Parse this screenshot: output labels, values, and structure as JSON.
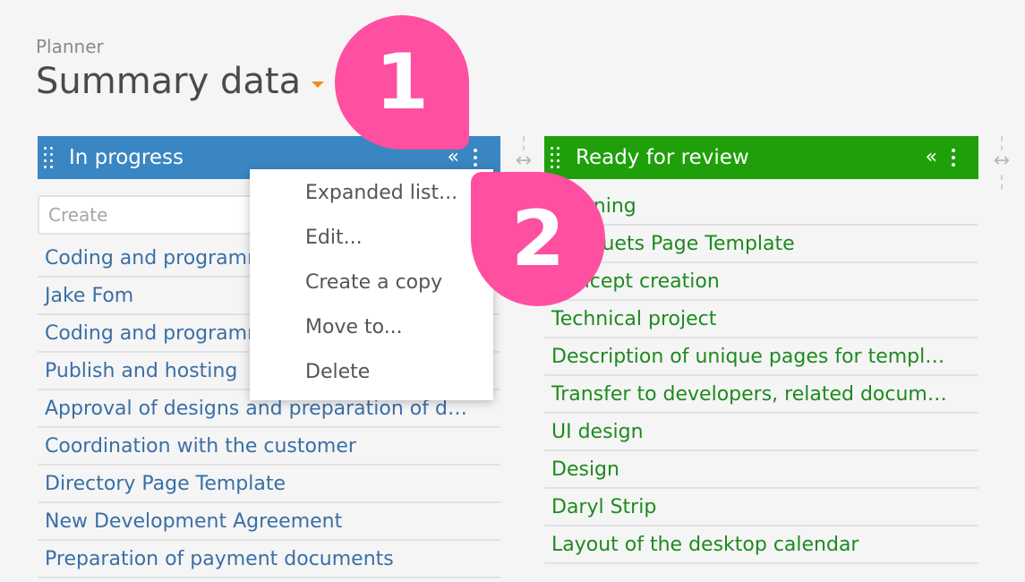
{
  "header": {
    "breadcrumb": "Planner",
    "title": "Summary data"
  },
  "columns": [
    {
      "title": "In progress",
      "color": "#3a86c2",
      "create_placeholder": "Create",
      "cards": [
        "Coding and programming",
        "Jake Fom",
        "Coding and programming",
        "Publish and hosting",
        "Approval of designs and preparation of d…",
        "Coordination with the customer",
        "Directory Page Template",
        "New Development Agreement",
        "Preparation of payment documents"
      ]
    },
    {
      "title": "Ready for review",
      "color": "#1fa00a",
      "cards": [
        "Planning",
        "Bouquets Page Template",
        "Concept creation",
        "Technical project",
        "Description of unique pages for templ…",
        "Transfer to developers, related docum…",
        "UI design",
        "Design",
        "Daryl Strip",
        "Layout of the desktop calendar"
      ]
    }
  ],
  "context_menu": {
    "items": [
      "Expanded list...",
      "Edit...",
      "Create a copy",
      "Move to...",
      "Delete"
    ]
  },
  "callouts": [
    "1",
    "2"
  ],
  "icons": {
    "collapse": "«",
    "resize": "↔",
    "title_dropdown": "caret-down",
    "more": "vertical-ellipsis",
    "drag": "drag-dots"
  },
  "colors": {
    "accent_orange": "#f08c1e",
    "callout_pink": "#ff4fa0",
    "in_progress_text": "#3a6fa6",
    "review_text": "#1e8a1e"
  }
}
